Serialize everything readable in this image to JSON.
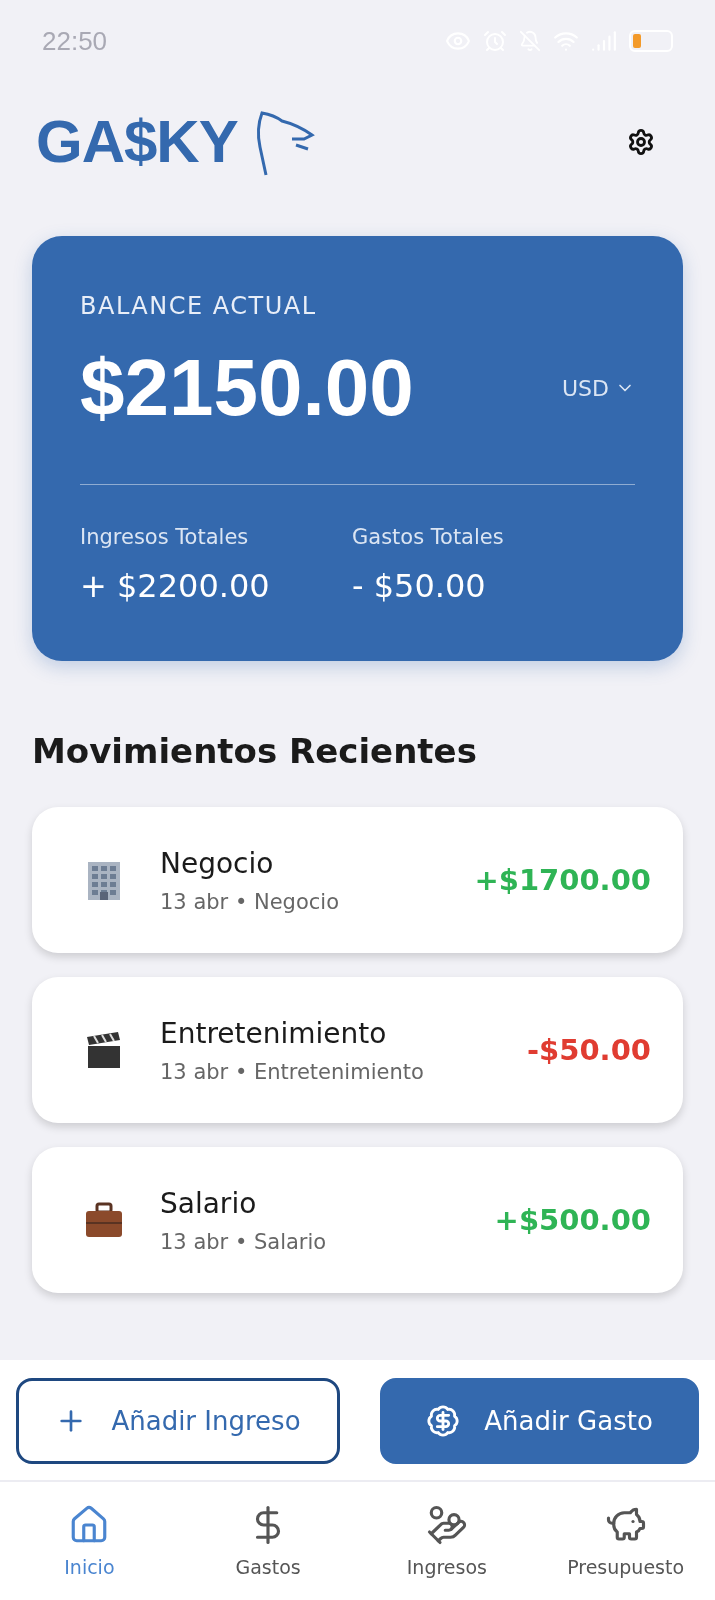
{
  "status_bar": {
    "time": "22:50"
  },
  "header": {
    "logo": "GA$KY"
  },
  "balance": {
    "label": "BALANCE ACTUAL",
    "amount": "$2150.00",
    "currency": "USD",
    "stats": [
      {
        "label": "Ingresos Totales",
        "value": "+ $2200.00"
      },
      {
        "label": "Gastos Totales",
        "value": "- $50.00"
      }
    ]
  },
  "recent": {
    "title": "Movimientos Recientes",
    "items": [
      {
        "name": "Negocio",
        "meta": "13 abr • Negocio",
        "amount": "+$1700.00",
        "kind": "income"
      },
      {
        "name": "Entretenimiento",
        "meta": "13 abr • Entretenimiento",
        "amount": "-$50.00",
        "kind": "expense"
      },
      {
        "name": "Salario",
        "meta": "13 abr • Salario",
        "amount": "+$500.00",
        "kind": "income"
      }
    ]
  },
  "actions": [
    {
      "label": "Añadir Ingreso",
      "kind": "outline"
    },
    {
      "label": "Añadir Gasto",
      "kind": "filled"
    }
  ],
  "nav": [
    {
      "label": "Inicio",
      "selected": true
    },
    {
      "label": "Gastos",
      "selected": false
    },
    {
      "label": "Ingresos",
      "selected": false
    },
    {
      "label": "Presupuesto",
      "selected": false
    }
  ]
}
